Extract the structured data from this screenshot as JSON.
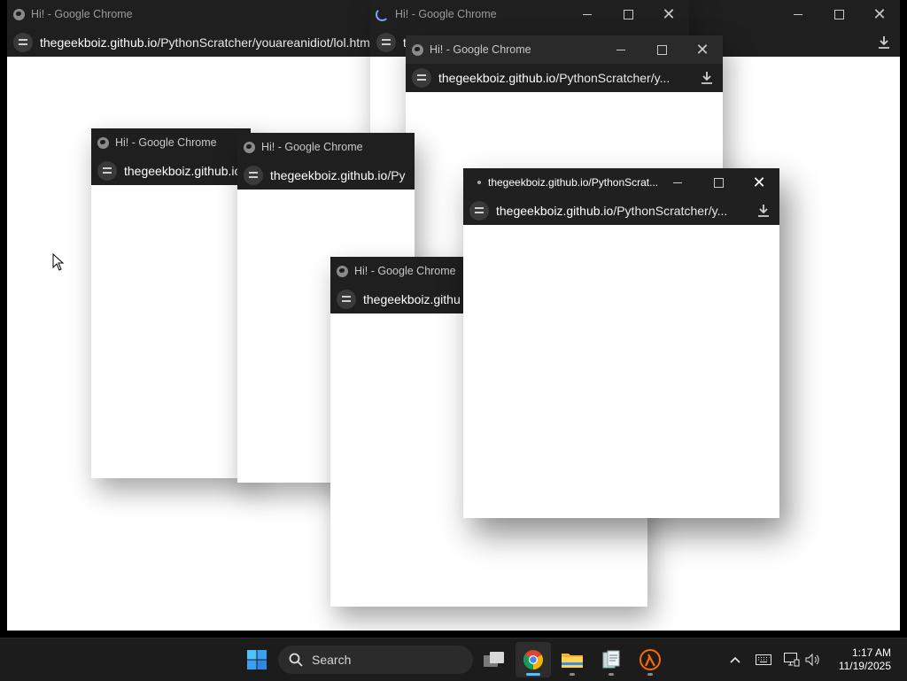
{
  "windows": [
    {
      "title": "Hi! - Google Chrome",
      "url_host": "thegeekboiz.github.io",
      "url_path": "/PythonScratcher/youareanidiot/lol.html"
    },
    {
      "title": "Hi! - Google Chrome",
      "url_host": "t",
      "url_path": ""
    },
    {
      "title": "Hi! - Google Chrome",
      "url_host": "thegeekboiz.github.io",
      "url_path": "/PythonScratcher/y..."
    },
    {
      "title": "Hi! - Google Chrome",
      "url_host": "thegeekboiz.github.io",
      "url_path": ""
    },
    {
      "title": "Hi! - Google Chrome",
      "url_host": "thegeekboiz.github.io",
      "url_path": "/Py"
    },
    {
      "title": "Hi! - Google Chrome",
      "url_host": "thegeekboiz.githu",
      "url_path": ""
    },
    {
      "title": "thegeekboiz.github.io/PythonScrat...",
      "url_host": "thegeekboiz.github.io",
      "url_path": "/PythonScratcher/y..."
    }
  ],
  "taskbar": {
    "search_label": "Search",
    "apps": [
      "windows-start",
      "search",
      "task-view",
      "chrome",
      "file-explorer",
      "app-notepad",
      "half-life"
    ],
    "clock_time": "1:17 AM",
    "clock_date": "11/19/2025"
  },
  "colors": {
    "titlebar": "#1f1f1f",
    "taskbar": "#1c1c1c",
    "accent": "#4cc2ff"
  }
}
